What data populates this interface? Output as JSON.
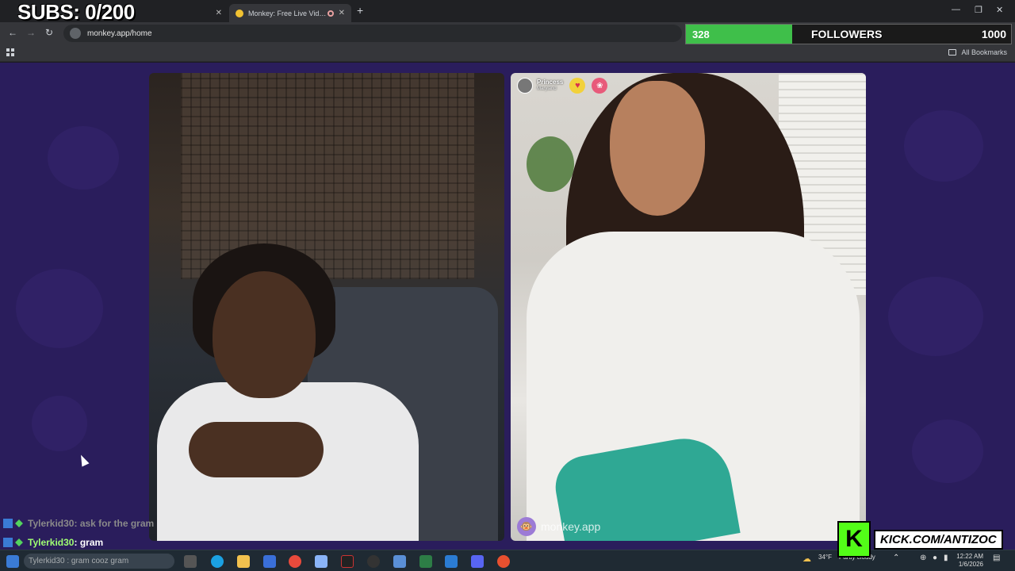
{
  "browser": {
    "tabs": [
      {
        "title": "",
        "active": false
      },
      {
        "title": "Monkey: Free Live Video C",
        "active": true
      }
    ],
    "url": "monkey.app/home",
    "bookmarks_label": "All Bookmarks"
  },
  "stream_overlay": {
    "subs_label": "SUBS: 0/200",
    "followers": {
      "current": "328",
      "label": "FOLLOWERS",
      "goal": "1000",
      "progress": 0.328
    },
    "chat": [
      {
        "user": "Tylerkid30",
        "message": " : ask for the gram"
      },
      {
        "user": "Tylerkid30",
        "message": " : gram"
      }
    ],
    "kick_handle": "KICK.COM/ANTIZOC"
  },
  "video_call": {
    "partner": {
      "name": "Princess",
      "location": "Maryland"
    },
    "watermark": "monkey.app"
  },
  "taskbar": {
    "search_text": "Tylerkid30 : gram cooz gram",
    "weather": "34°F",
    "weather_desc": "Partly cloudy",
    "time": "12:22 AM",
    "date": "1/6/2026"
  }
}
